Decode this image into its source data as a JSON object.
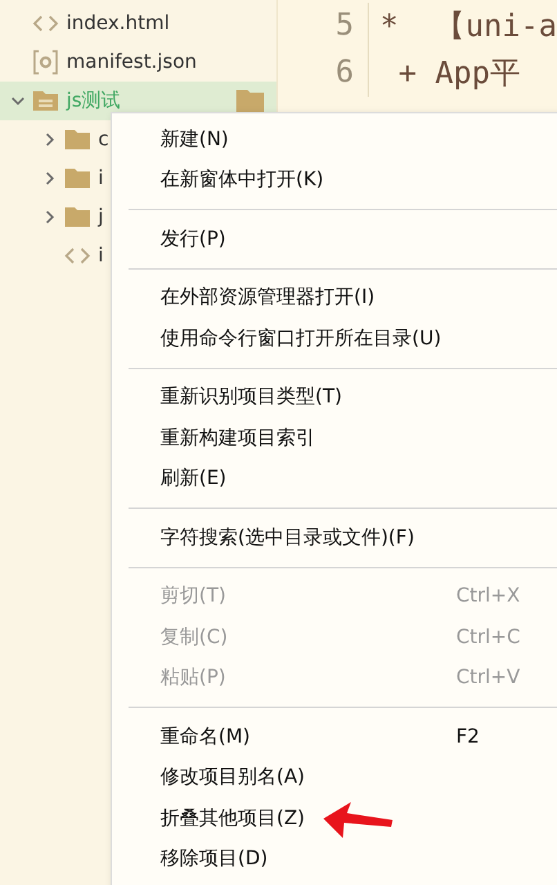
{
  "tree": [
    {
      "name": "index.html",
      "kind": "code",
      "selected": false,
      "expandable": false
    },
    {
      "name": "manifest.json",
      "kind": "config",
      "selected": false,
      "expandable": false
    },
    {
      "name": "js测试",
      "kind": "project",
      "selected": true,
      "expandable": true,
      "expanded": true,
      "children": [
        {
          "name": "c",
          "kind": "folder",
          "selected": false,
          "expandable": true,
          "expanded": false
        },
        {
          "name": "i",
          "kind": "folder",
          "selected": false,
          "expandable": true,
          "expanded": false
        },
        {
          "name": "j",
          "kind": "folder",
          "selected": false,
          "expandable": true,
          "expanded": false
        },
        {
          "name": "i",
          "kind": "code",
          "selected": false,
          "expandable": false
        }
      ]
    }
  ],
  "editor": {
    "lines": [
      {
        "number": "5",
        "code": "*  【uni-a"
      },
      {
        "number": "6",
        "code": " + App平"
      }
    ]
  },
  "context_menu": {
    "items": [
      {
        "kind": "item",
        "label": "新建(N)",
        "disabled": false
      },
      {
        "kind": "item",
        "label": "在新窗体中打开(K)",
        "disabled": false
      },
      {
        "kind": "separator"
      },
      {
        "kind": "item",
        "label": "发行(P)",
        "disabled": false
      },
      {
        "kind": "separator"
      },
      {
        "kind": "item",
        "label": "在外部资源管理器打开(I)",
        "disabled": false
      },
      {
        "kind": "item",
        "label": "使用命令行窗口打开所在目录(U)",
        "disabled": false
      },
      {
        "kind": "separator"
      },
      {
        "kind": "item",
        "label": "重新识别项目类型(T)",
        "disabled": false
      },
      {
        "kind": "item",
        "label": "重新构建项目索引",
        "disabled": false
      },
      {
        "kind": "item",
        "label": "刷新(E)",
        "disabled": false
      },
      {
        "kind": "separator"
      },
      {
        "kind": "item",
        "label": "字符搜索(选中目录或文件)(F)",
        "disabled": false
      },
      {
        "kind": "separator"
      },
      {
        "kind": "item",
        "label": "剪切(T)",
        "shortcut": "Ctrl+X",
        "disabled": true
      },
      {
        "kind": "item",
        "label": "复制(C)",
        "shortcut": "Ctrl+C",
        "disabled": true
      },
      {
        "kind": "item",
        "label": "粘贴(P)",
        "shortcut": "Ctrl+V",
        "disabled": true
      },
      {
        "kind": "separator"
      },
      {
        "kind": "item",
        "label": "重命名(M)",
        "shortcut": "F2",
        "disabled": false
      },
      {
        "kind": "item",
        "label": "修改项目别名(A)",
        "disabled": false
      },
      {
        "kind": "item",
        "label": "折叠其他项目(Z)",
        "disabled": false,
        "pointed": true
      },
      {
        "kind": "item",
        "label": "移除项目(D)",
        "disabled": false
      }
    ]
  }
}
